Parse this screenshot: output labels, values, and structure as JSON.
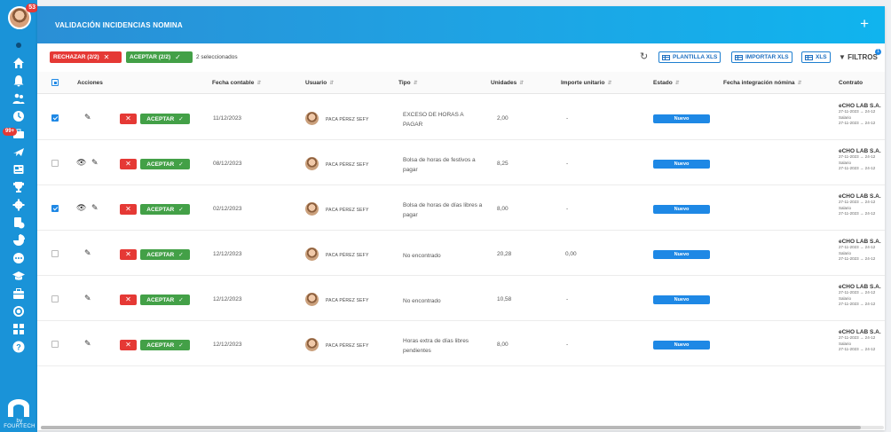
{
  "sidebar": {
    "avatar_badge": "53",
    "calendar_badge": "99+",
    "logo_text": "by FOURTECH",
    "icons": [
      "dot-icon",
      "home-icon",
      "bell-icon",
      "users-icon",
      "clock-icon",
      "briefcase-icon",
      "plane-icon",
      "document-icon",
      "trophy-icon",
      "gear-icon",
      "payroll-icon",
      "pie-chart-icon",
      "chat-icon",
      "graduation-icon",
      "toolbox-icon",
      "target-icon",
      "grid-icon",
      "help-icon"
    ]
  },
  "header": {
    "title": "VALIDACIÓN INCIDENCIAS NOMINA",
    "add_label": "+"
  },
  "toolbar": {
    "reject_label": "RECHAZAR (2/2)",
    "accept_label": "ACEPTAR (2/2)",
    "selected_text": "2 seleccionados",
    "plantilla_label": "PLANTILLA XLS",
    "importar_label": "IMPORTAR XLS",
    "xls_label": "XLS",
    "filtros_label": "FILTROS",
    "filtros_badge": "1"
  },
  "columns": {
    "acciones": "Acciones",
    "fecha": "Fecha contable",
    "usuario": "Usuario",
    "tipo": "Tipo",
    "unidades": "Unidades",
    "importe": "Importe unitario",
    "estado": "Estado",
    "integracion": "Fecha integración nómina",
    "contrato": "Contrato"
  },
  "row_labels": {
    "accept": "ACEPTAR",
    "reject_icon": "✕",
    "accept_icon": "✓"
  },
  "rows": [
    {
      "checked": true,
      "view": false,
      "fecha": "11/12/2023",
      "usuario": "PACA PÉREZ SEFY",
      "tipo": "EXCESO DE HORAS A PAGAR",
      "unidades": "2,00",
      "importe": "-",
      "estado": "Nuevo",
      "contrato": "eCHO LAB S.A.",
      "c_line1": "27-11-2023 → 24-12",
      "c_line2": "Salario",
      "c_line3": "27-11-2023 → 24-12"
    },
    {
      "checked": false,
      "view": true,
      "fecha": "08/12/2023",
      "usuario": "PACA PÉREZ SEFY",
      "tipo": "Bolsa de horas de festivos a pagar",
      "unidades": "8,25",
      "importe": "-",
      "estado": "Nuevo",
      "contrato": "eCHO LAB S.A.",
      "c_line1": "27-11-2023 → 24-12",
      "c_line2": "Salario",
      "c_line3": "27-11-2023 → 24-12"
    },
    {
      "checked": true,
      "view": true,
      "fecha": "02/12/2023",
      "usuario": "PACA PÉREZ SEFY",
      "tipo": "Bolsa de horas de días libres a pagar",
      "unidades": "8,00",
      "importe": "-",
      "estado": "Nuevo",
      "contrato": "eCHO LAB S.A.",
      "c_line1": "27-11-2023 → 24-12",
      "c_line2": "Salario",
      "c_line3": "27-11-2023 → 24-12"
    },
    {
      "checked": false,
      "view": false,
      "fecha": "12/12/2023",
      "usuario": "PACA PÉREZ SEFY",
      "tipo": "No encontrado",
      "unidades": "20,28",
      "importe": "0,00",
      "estado": "Nuevo",
      "contrato": "eCHO LAB S.A.",
      "c_line1": "27-11-2023 → 24-12",
      "c_line2": "Salario",
      "c_line3": "27-11-2023 → 24-12"
    },
    {
      "checked": false,
      "view": false,
      "fecha": "12/12/2023",
      "usuario": "PACA PÉREZ SEFY",
      "tipo": "No encontrado",
      "unidades": "10,58",
      "importe": "-",
      "estado": "Nuevo",
      "contrato": "eCHO LAB S.A.",
      "c_line1": "27-11-2023 → 24-12",
      "c_line2": "Salario",
      "c_line3": "27-11-2023 → 24-12"
    },
    {
      "checked": false,
      "view": false,
      "fecha": "12/12/2023",
      "usuario": "PACA PÉREZ SEFY",
      "tipo": "Horas extra de días libres pendientes",
      "unidades": "8,00",
      "importe": "-",
      "estado": "Nuevo",
      "contrato": "eCHO LAB S.A.",
      "c_line1": "27-11-2023 → 24-12",
      "c_line2": "Salario",
      "c_line3": "27-11-2023 → 24-12"
    }
  ]
}
